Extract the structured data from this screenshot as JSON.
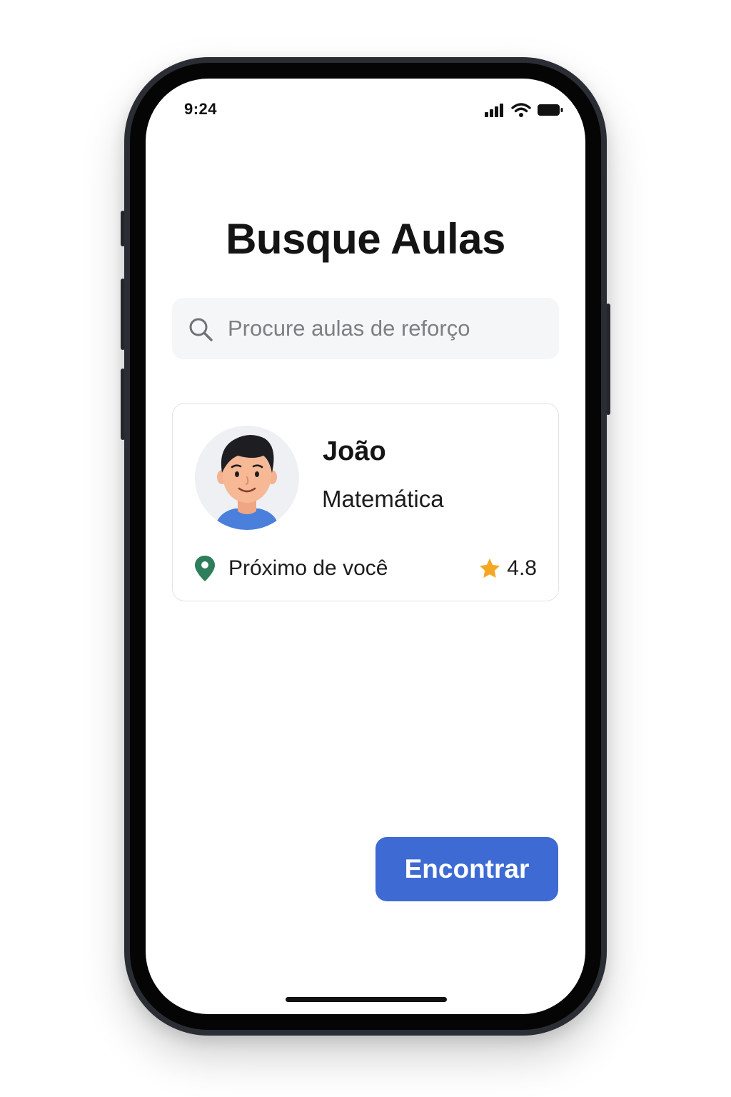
{
  "status_bar": {
    "time": "9:24",
    "icons": [
      "signal-icon",
      "wifi-icon",
      "battery-icon"
    ]
  },
  "page": {
    "title": "Busque Aulas"
  },
  "search": {
    "placeholder": "Procure aulas de reforço",
    "value": "",
    "icon": "search-icon"
  },
  "tutor_card": {
    "name": "João",
    "subject": "Matemática",
    "location_text": "Próximo de você",
    "location_icon": "location-pin-icon",
    "rating": "4.8",
    "rating_icon": "star-icon"
  },
  "actions": {
    "find_label": "Encontrar"
  },
  "colors": {
    "accent": "#3d6bd3",
    "pin": "#2e7d5b",
    "star": "#f5a623",
    "search_bg": "#f5f6f8"
  }
}
